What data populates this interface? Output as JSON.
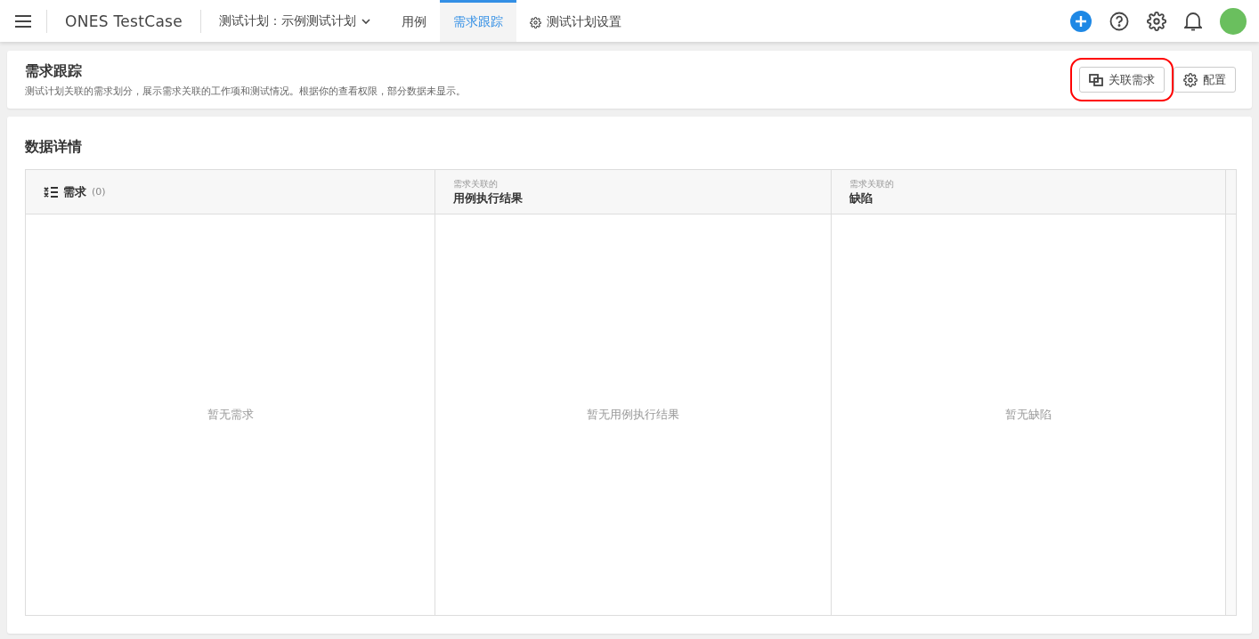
{
  "topbar": {
    "product": "ONES TestCase",
    "plan_selector": "测试计划：示例测试计划",
    "tabs": [
      {
        "label": "用例",
        "kind": "plain",
        "selected": false
      },
      {
        "label": "需求跟踪",
        "kind": "plain",
        "selected": true
      },
      {
        "label": "测试计划设置",
        "kind": "gear",
        "selected": false
      }
    ]
  },
  "header": {
    "title": "需求跟踪",
    "description": "测试计划关联的需求划分，展示需求关联的工作项和测试情况。根据你的查看权限，部分数据未显示。",
    "buttons": [
      {
        "label": "关联需求",
        "kind": "link",
        "highlighted": true
      },
      {
        "label": "配置",
        "kind": "gear",
        "highlighted": false
      }
    ]
  },
  "details": {
    "title": "数据详情",
    "columns": [
      {
        "kind": "main",
        "label": "需求",
        "count": "(0)",
        "empty_text": "暂无需求"
      },
      {
        "kind": "related",
        "caption": "需求关联的",
        "label": "用例执行结果",
        "empty_text": "暂无用例执行结果"
      },
      {
        "kind": "related",
        "caption": "需求关联的",
        "label": "缺陷",
        "empty_text": "暂无缺陷"
      }
    ]
  }
}
